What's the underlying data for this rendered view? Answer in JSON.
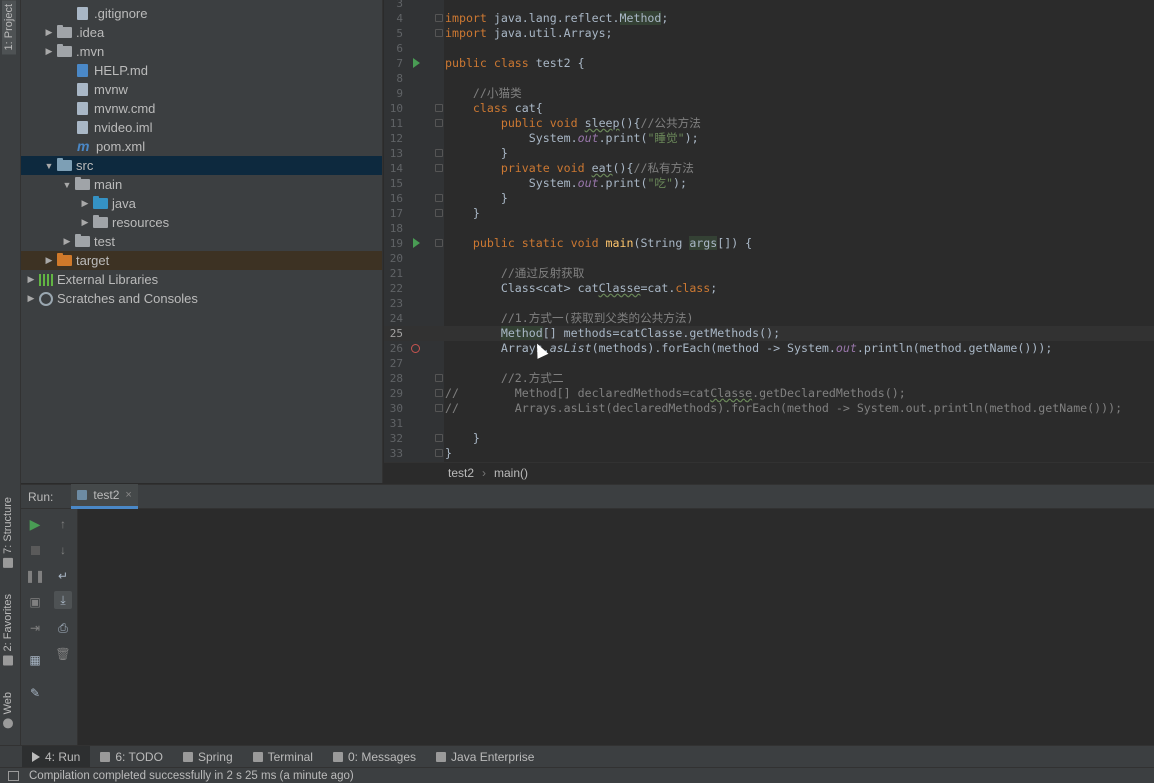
{
  "left_strip": {
    "project_tab": "1: Project",
    "structure_tab": "7: Structure",
    "favorites_tab": "2: Favorites",
    "web_tab": "Web"
  },
  "tree": [
    {
      "label": ".gitignore",
      "kind": "file",
      "indent": 2,
      "arrow": ""
    },
    {
      "label": ".idea",
      "kind": "folder",
      "indent": 1,
      "arrow": "▶"
    },
    {
      "label": ".mvn",
      "kind": "folder",
      "indent": 1,
      "arrow": "▶"
    },
    {
      "label": "HELP.md",
      "kind": "md",
      "indent": 2,
      "arrow": ""
    },
    {
      "label": "mvnw",
      "kind": "file",
      "indent": 2,
      "arrow": ""
    },
    {
      "label": "mvnw.cmd",
      "kind": "file",
      "indent": 2,
      "arrow": ""
    },
    {
      "label": "nvideo.iml",
      "kind": "file",
      "indent": 2,
      "arrow": ""
    },
    {
      "label": "pom.xml",
      "kind": "maven",
      "indent": 2,
      "arrow": ""
    },
    {
      "label": "src",
      "kind": "src",
      "indent": 1,
      "arrow": "▼",
      "state": "selected"
    },
    {
      "label": "main",
      "kind": "folder",
      "indent": 2,
      "arrow": "▼"
    },
    {
      "label": "java",
      "kind": "blue",
      "indent": 3,
      "arrow": "▶"
    },
    {
      "label": "resources",
      "kind": "res",
      "indent": 3,
      "arrow": "▶"
    },
    {
      "label": "test",
      "kind": "folder",
      "indent": 2,
      "arrow": "▶"
    },
    {
      "label": "target",
      "kind": "orange",
      "indent": 1,
      "arrow": "▶",
      "state": "excluded"
    },
    {
      "label": "External Libraries",
      "kind": "lib",
      "indent": 0,
      "arrow": "▶"
    },
    {
      "label": "Scratches and Consoles",
      "kind": "scratch",
      "indent": 0,
      "arrow": "▶"
    }
  ],
  "code": [
    {
      "n": "3",
      "t": ""
    },
    {
      "n": "4",
      "html": "<span class=\"kw\">import</span> java.lang.reflect.<span class=\"hl\">Method</span>;"
    },
    {
      "n": "5",
      "html": "<span class=\"kw\">import</span> java.util.Arrays;"
    },
    {
      "n": "6",
      "t": ""
    },
    {
      "n": "7",
      "html": "<span class=\"kw\">public class</span> test2 {"
    },
    {
      "n": "8",
      "t": ""
    },
    {
      "n": "9",
      "html": "    <span class=\"cm\">//小猫类</span>"
    },
    {
      "n": "10",
      "html": "    <span class=\"kw\">class</span> cat{"
    },
    {
      "n": "11",
      "html": "        <span class=\"kw\">public void</span> <span class=\"und\">sleep</span>(){<span class=\"cm\">//公共方法</span>"
    },
    {
      "n": "12",
      "html": "            System.<span class=\"fld\">out</span>.print(<span class=\"str\">\"睡觉\"</span>);"
    },
    {
      "n": "13",
      "html": "        }"
    },
    {
      "n": "14",
      "html": "        <span class=\"kw\">private void</span> <span class=\"und\">eat</span>(){<span class=\"cm\">//私有方法</span>"
    },
    {
      "n": "15",
      "html": "            System.<span class=\"fld\">out</span>.print(<span class=\"str\">\"吃\"</span>);"
    },
    {
      "n": "16",
      "html": "        }"
    },
    {
      "n": "17",
      "html": "    }"
    },
    {
      "n": "18",
      "t": ""
    },
    {
      "n": "19",
      "html": "    <span class=\"kw\">public static void</span> <span class=\"fn\">main</span>(String <span class=\"hl\">args</span>[]) {"
    },
    {
      "n": "20",
      "t": ""
    },
    {
      "n": "21",
      "html": "        <span class=\"cm\">//通过反射获取</span>"
    },
    {
      "n": "22",
      "html": "        Class&lt;cat&gt; cat<span class=\"und\">Classe</span>=cat.<span class=\"kw\">class</span>;"
    },
    {
      "n": "23",
      "t": ""
    },
    {
      "n": "24",
      "html": "        <span class=\"cm\">//1.方式一(获取到父类的公共方法)</span>"
    },
    {
      "n": "25",
      "html": "        <span class=\"hl\">Method</span>[] methods=catClasse.getMethods();",
      "current": true
    },
    {
      "n": "26",
      "html": "        Arrays.<span class=\"it\">asList</span>(methods).forEach(method -&gt; System.<span class=\"fld\">out</span>.println(method.getName()));"
    },
    {
      "n": "27",
      "t": ""
    },
    {
      "n": "28",
      "html": "        <span class=\"cm\">//2.方式二</span>"
    },
    {
      "n": "29",
      "html": "<span class=\"cm\">//        Method[] declaredMethods=cat<span class=\"und\">Classe</span>.getDeclaredMethods();</span>"
    },
    {
      "n": "30",
      "html": "<span class=\"cm\">//        Arrays.asList(declaredMethods).forEach(method -&gt; System.out.println(method.getName()));</span>"
    },
    {
      "n": "31",
      "t": ""
    },
    {
      "n": "32",
      "html": "    }"
    },
    {
      "n": "33",
      "html": "}"
    }
  ],
  "breadcrumb": {
    "cls": "test2",
    "method": "main()"
  },
  "run": {
    "title": "Run:",
    "tab": "test2",
    "close": "×"
  },
  "run_toolbar": [
    "rerun",
    "stop",
    "pause",
    "snapshot",
    "exit",
    "layout",
    "pin",
    "up",
    "down",
    "soft-wrap",
    "scroll-end",
    "print",
    "trash"
  ],
  "bottom_tools": [
    {
      "label": "4: Run",
      "active": true
    },
    {
      "label": "6: TODO"
    },
    {
      "label": "Spring"
    },
    {
      "label": "Terminal"
    },
    {
      "label": "0: Messages"
    },
    {
      "label": "Java Enterprise"
    }
  ],
  "status": "Compilation completed successfully in 2 s 25 ms (a minute ago)"
}
